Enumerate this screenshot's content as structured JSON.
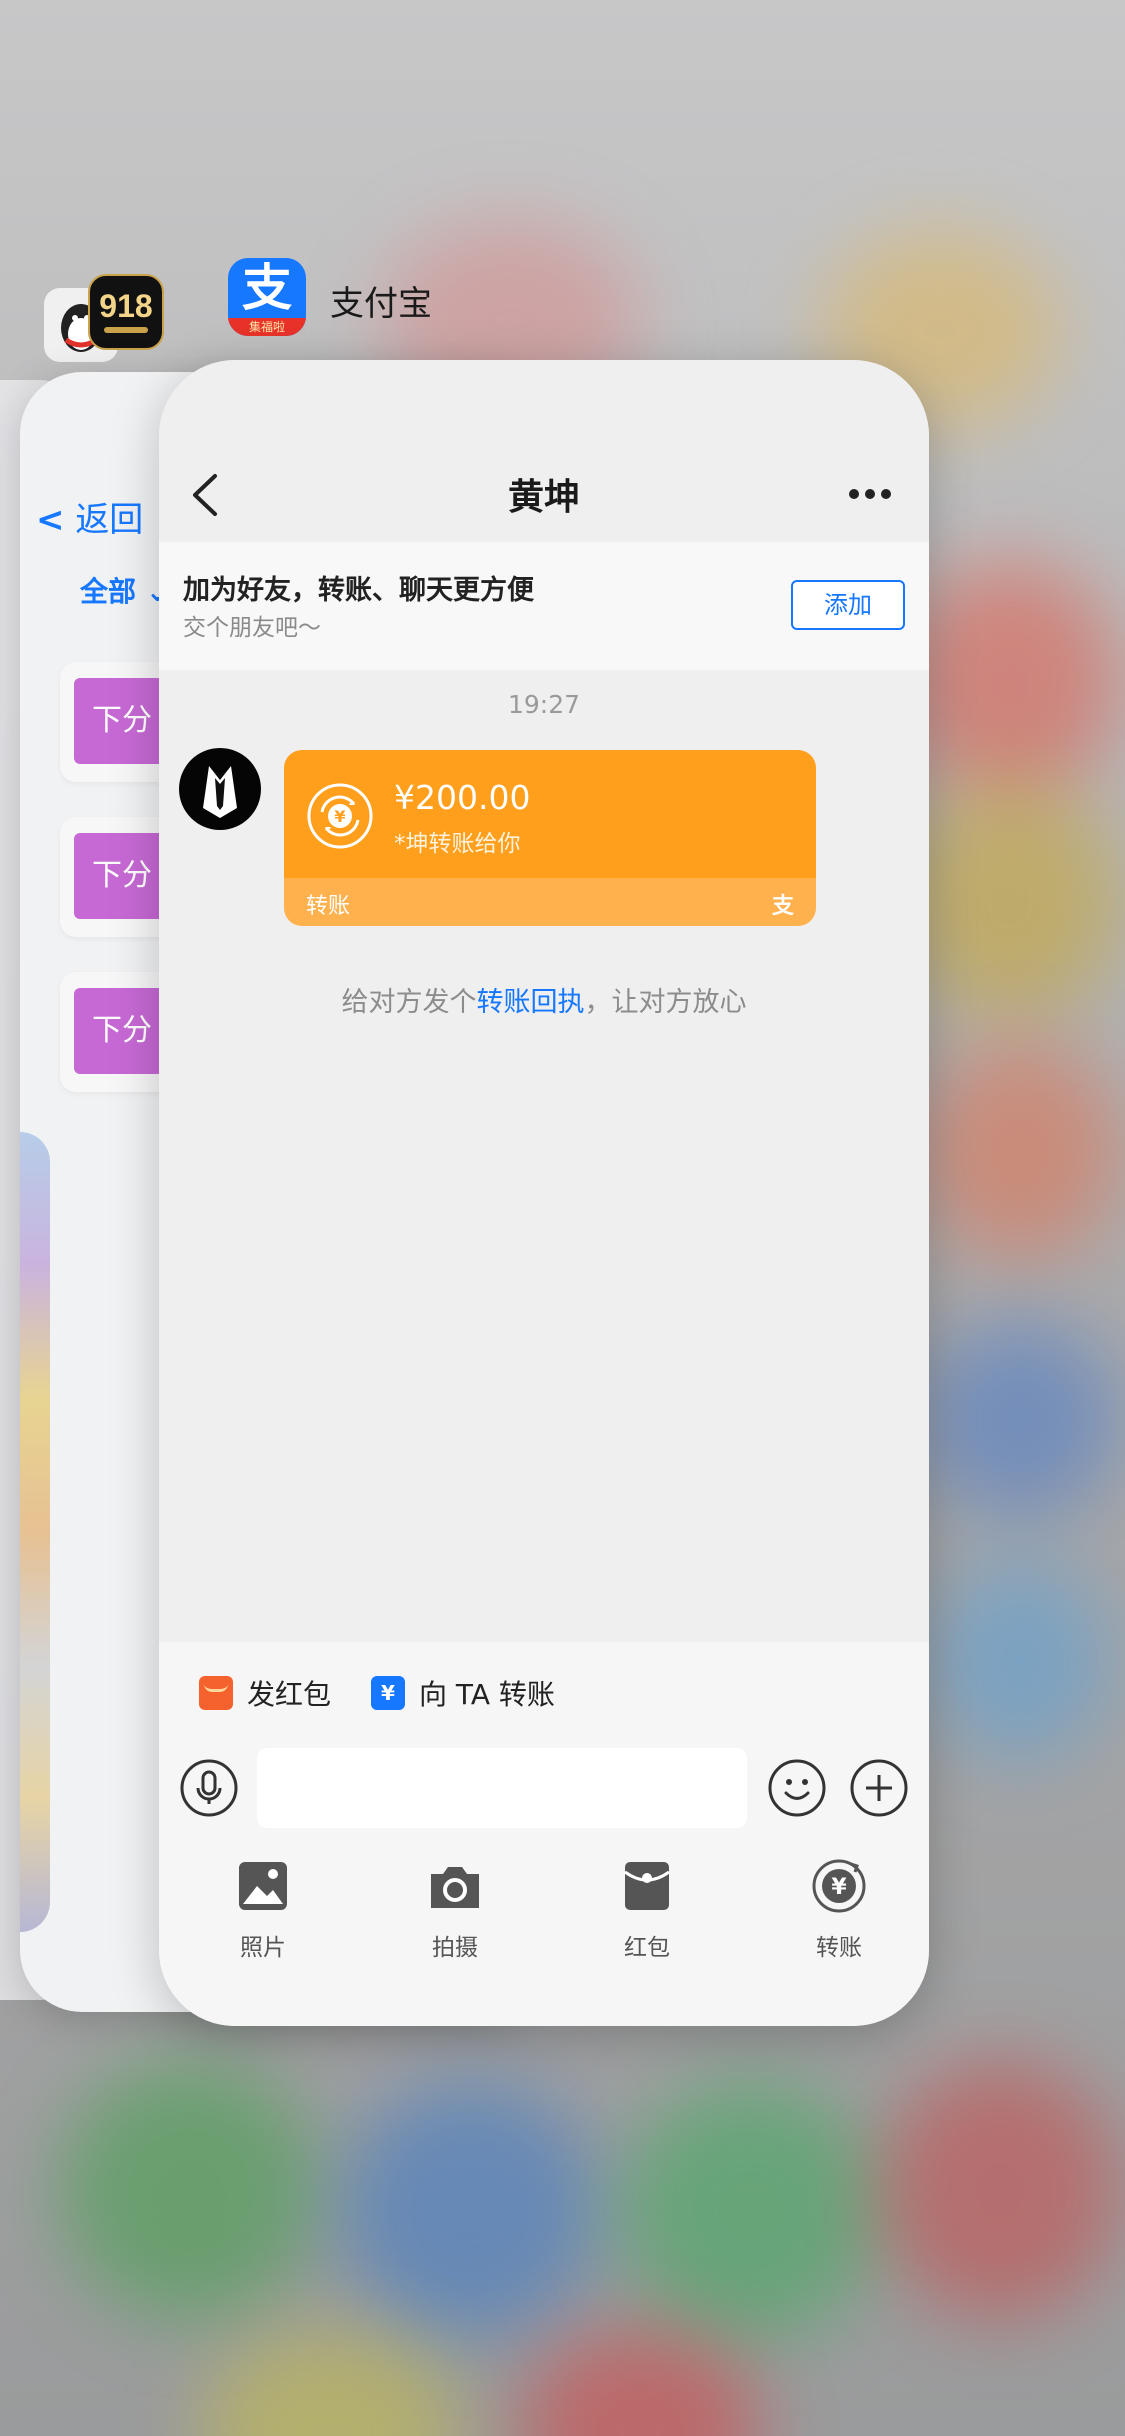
{
  "background_apps": {
    "qq_icon": "penguin-icon",
    "game_app_icon_text": "918",
    "behind_card": {
      "back_label": "返回",
      "filter_label": "全部",
      "chip_text": "下分"
    }
  },
  "alipay_app": {
    "name": "支付宝",
    "icon_char": "支",
    "icon_badge": "集福啦",
    "accent_color": "#1677ff"
  },
  "chat": {
    "title": "黄坤",
    "banner": {
      "title": "加为好友，转账、聊天更方便",
      "subtitle": "交个朋友吧～",
      "add_button": "添加"
    },
    "timestamp": "19:27",
    "transfer": {
      "amount": "¥200.00",
      "note": "*坤转账给你",
      "label": "转账",
      "logo": "支",
      "color": "#ff9f1c"
    },
    "receipt_hint": {
      "prefix": "给对方发个",
      "link": "转账回执",
      "suffix": "，让对方放心"
    }
  },
  "composer": {
    "quick_actions": [
      {
        "label": "发红包",
        "icon": "red-envelope-icon"
      },
      {
        "label": "向 TA 转账",
        "icon": "transfer-icon"
      }
    ],
    "input_value": "",
    "tools": [
      {
        "label": "照片",
        "icon": "photo-icon"
      },
      {
        "label": "拍摄",
        "icon": "camera-icon"
      },
      {
        "label": "红包",
        "icon": "red-packet-icon"
      },
      {
        "label": "转账",
        "icon": "transfer-yuan-icon"
      }
    ]
  }
}
